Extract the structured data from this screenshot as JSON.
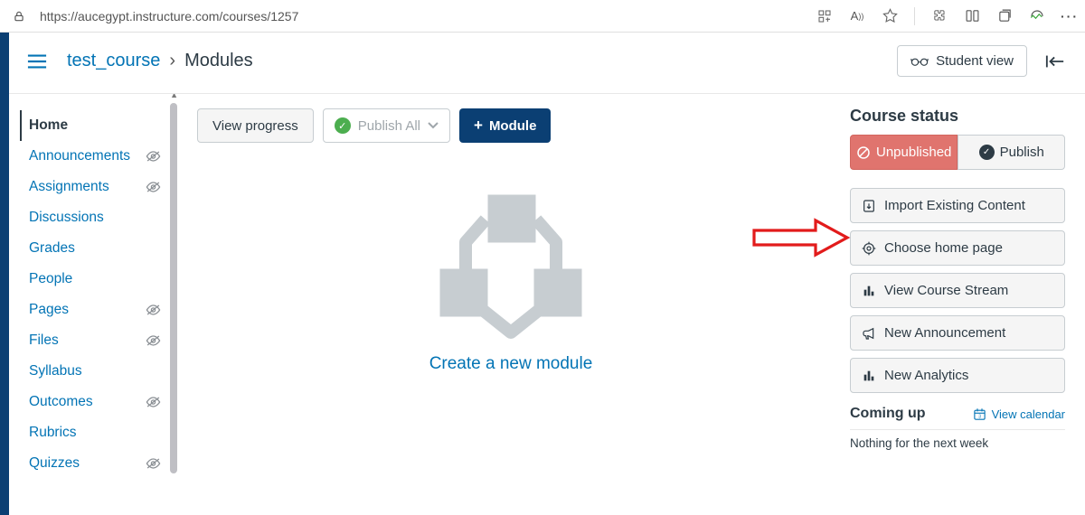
{
  "browser": {
    "url": "https://aucegypt.instructure.com/courses/1257"
  },
  "breadcrumb": {
    "course": "test_course",
    "current": "Modules"
  },
  "top_actions": {
    "student_view": "Student view"
  },
  "course_nav": [
    {
      "label": "Home",
      "active": true,
      "hidden": false
    },
    {
      "label": "Announcements",
      "active": false,
      "hidden": true
    },
    {
      "label": "Assignments",
      "active": false,
      "hidden": true
    },
    {
      "label": "Discussions",
      "active": false,
      "hidden": false
    },
    {
      "label": "Grades",
      "active": false,
      "hidden": false
    },
    {
      "label": "People",
      "active": false,
      "hidden": false
    },
    {
      "label": "Pages",
      "active": false,
      "hidden": true
    },
    {
      "label": "Files",
      "active": false,
      "hidden": true
    },
    {
      "label": "Syllabus",
      "active": false,
      "hidden": false
    },
    {
      "label": "Outcomes",
      "active": false,
      "hidden": true
    },
    {
      "label": "Rubrics",
      "active": false,
      "hidden": false
    },
    {
      "label": "Quizzes",
      "active": false,
      "hidden": true
    }
  ],
  "toolbar": {
    "view_progress": "View progress",
    "publish_all": "Publish All",
    "add_module": "Module"
  },
  "empty_state": {
    "link": "Create a new module"
  },
  "sidebar": {
    "status_heading": "Course status",
    "unpublished": "Unpublished",
    "publish": "Publish",
    "actions": [
      "Import Existing Content",
      "Choose home page",
      "View Course Stream",
      "New Announcement",
      "New Analytics"
    ],
    "coming_up": "Coming up",
    "view_calendar": "View calendar",
    "nothing": "Nothing for the next week"
  }
}
